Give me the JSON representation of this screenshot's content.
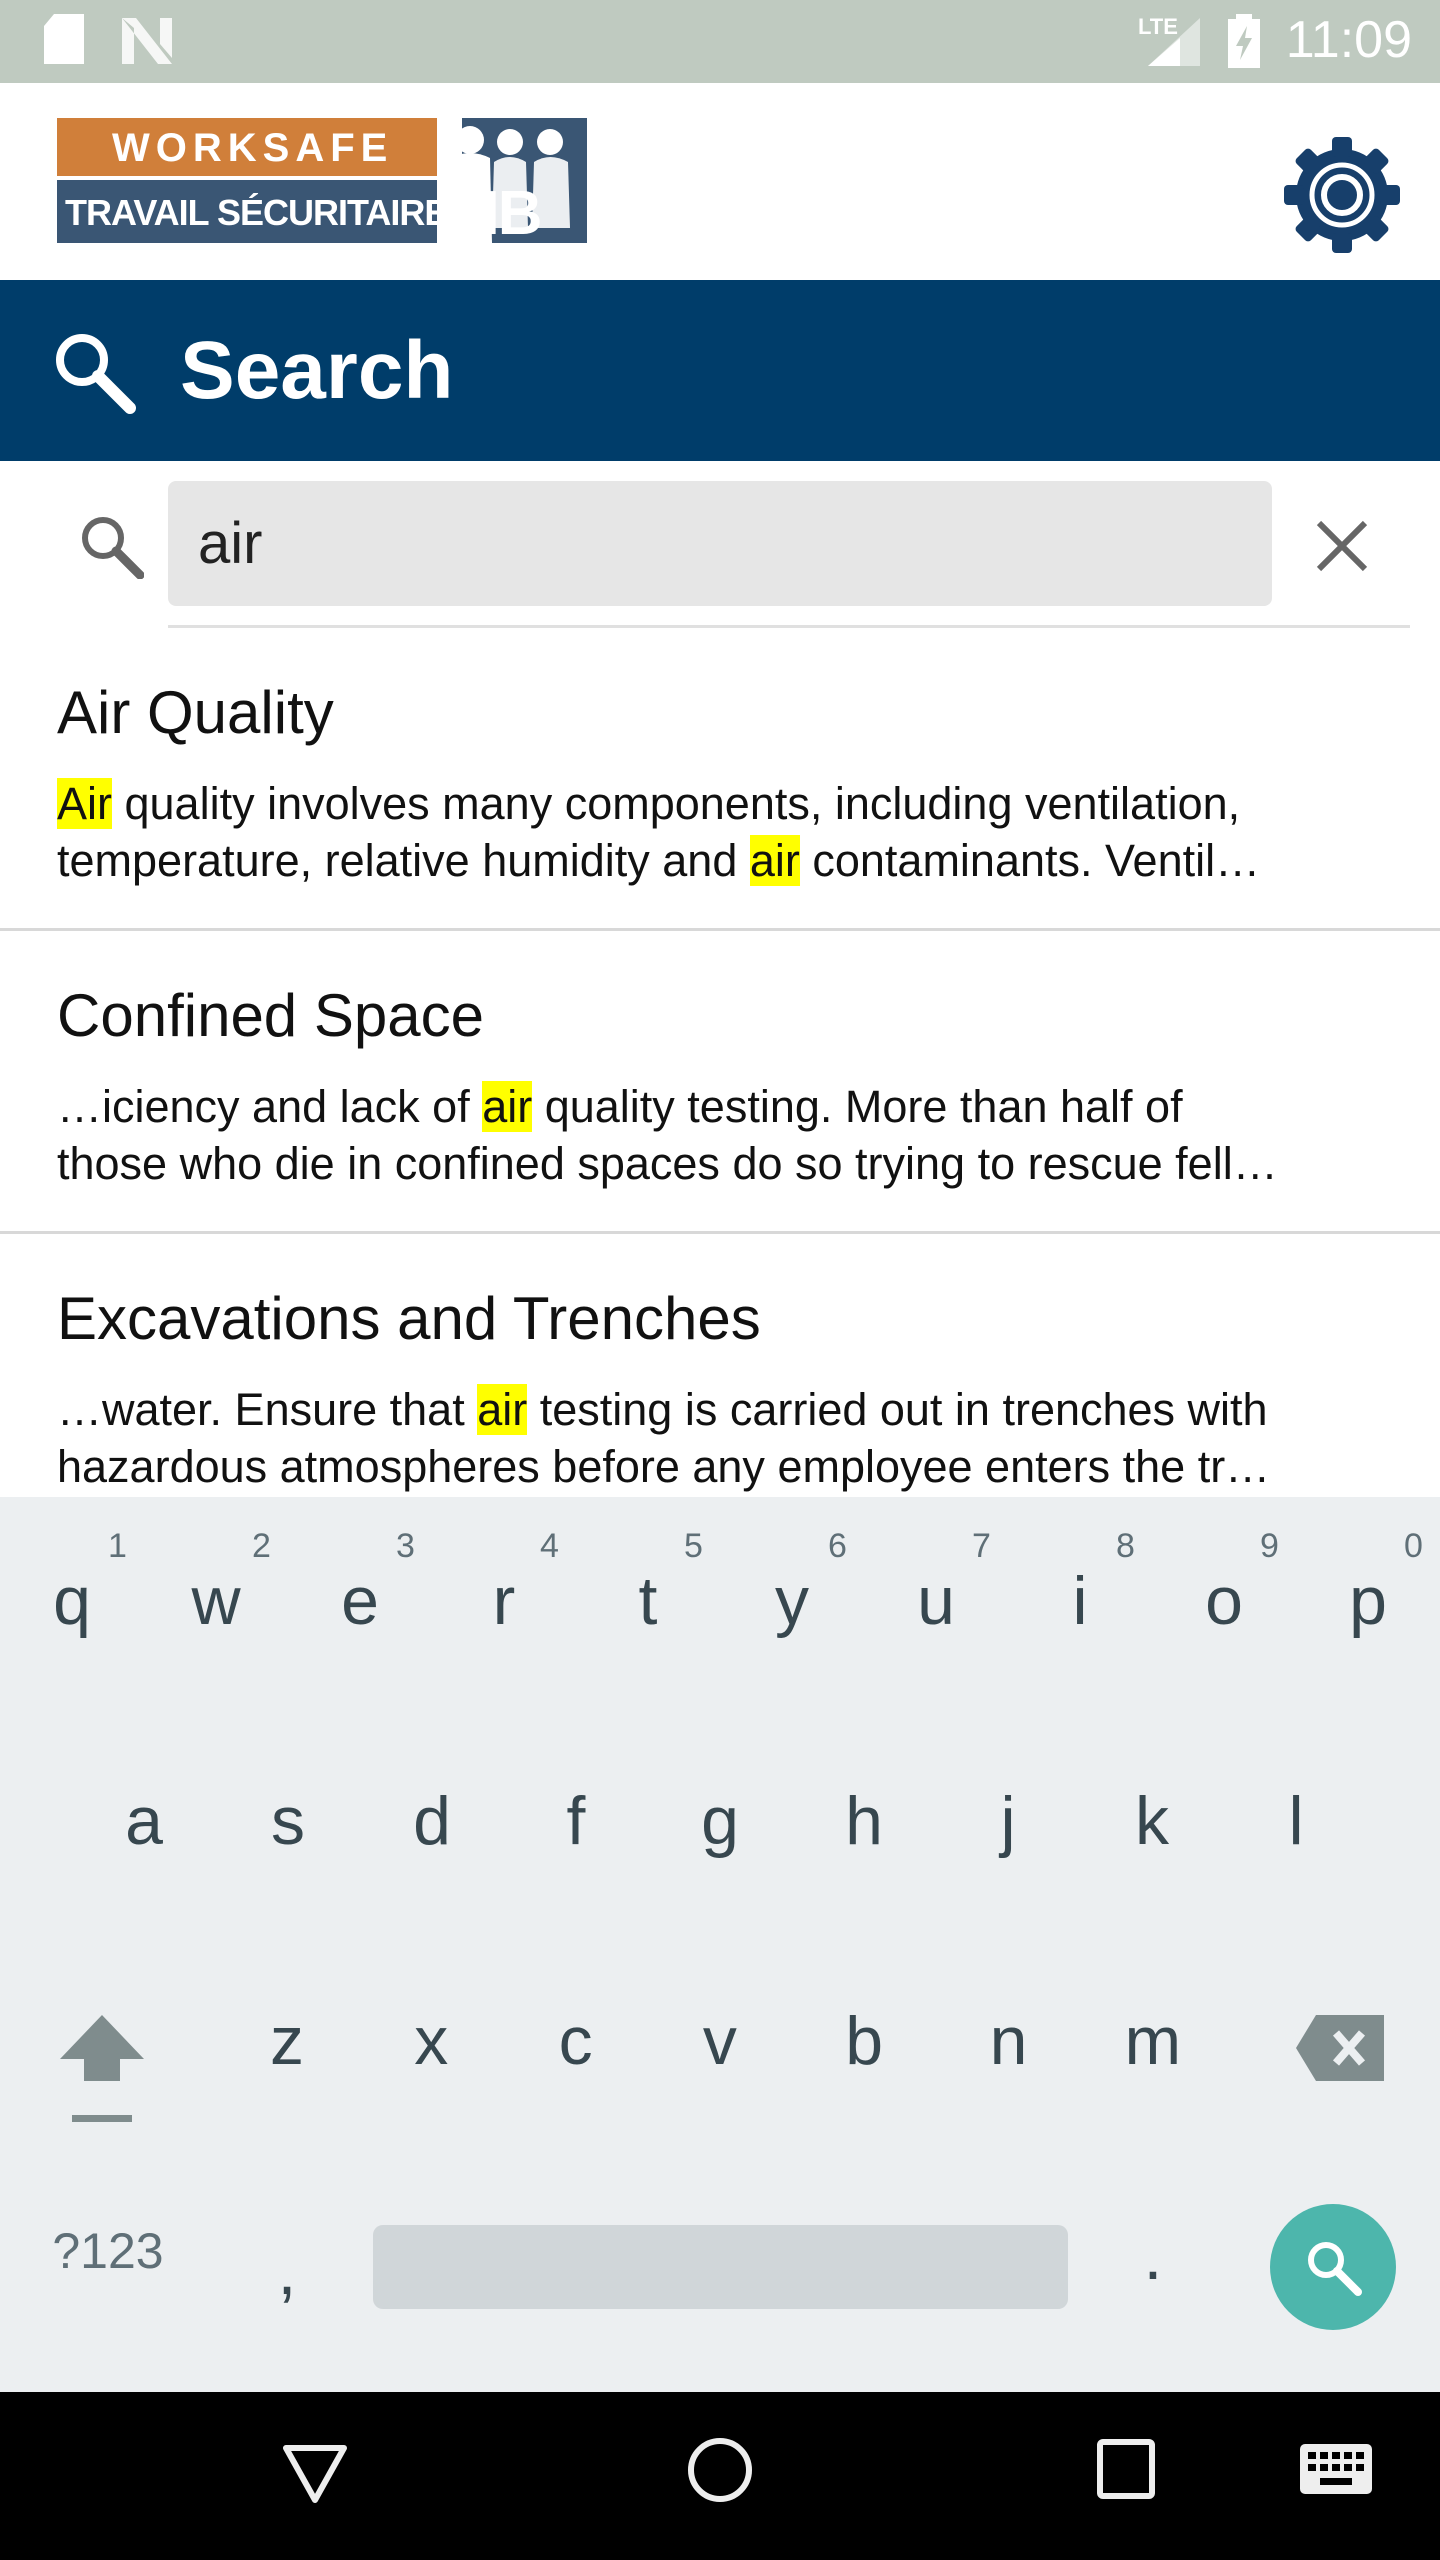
{
  "status_bar": {
    "time": "11:09",
    "network": "LTE",
    "icons": [
      "sd-card-icon",
      "n-icon",
      "signal-icon",
      "battery-charging-icon"
    ]
  },
  "header": {
    "logo_text_top": "WorkSafe",
    "logo_text_bottom": "Travail sécuritaire",
    "logo_text_nb": "NB",
    "settings_icon": "gear-icon"
  },
  "title_bar": {
    "title": "Search",
    "icon": "search-icon"
  },
  "search": {
    "value": "air",
    "placeholder": ""
  },
  "colors": {
    "title_bar": "#003d6a",
    "highlight": "#ffff00",
    "status_bar": "#bfcac0",
    "keyboard_action": "#4db6ac",
    "logo_orange": "#d07f3a",
    "logo_blue": "#3a5674"
  },
  "results": [
    {
      "title": "Air Quality",
      "lines": [
        [
          {
            "t": "Air",
            "hl": true
          },
          {
            "t": " quality involves many components, including ventilation,"
          }
        ],
        [
          {
            "t": "temperature, relative humidity and "
          },
          {
            "t": "air",
            "hl": true
          },
          {
            "t": " contaminants. Ventil…"
          }
        ]
      ]
    },
    {
      "title": "Confined Space",
      "lines": [
        [
          {
            "t": "…iciency and lack of "
          },
          {
            "t": "air",
            "hl": true
          },
          {
            "t": " quality testing. More than half of"
          }
        ],
        [
          {
            "t": "those who die in confined spaces do so trying to rescue fell…"
          }
        ]
      ]
    },
    {
      "title": "Excavations and Trenches",
      "lines": [
        [
          {
            "t": "…water. Ensure that "
          },
          {
            "t": "air",
            "hl": true
          },
          {
            "t": " testing is carried out in trenches with"
          }
        ],
        [
          {
            "t": "hazardous atmospheres before any employee enters the tr…"
          }
        ]
      ]
    }
  ],
  "keyboard": {
    "row1": [
      "q",
      "w",
      "e",
      "r",
      "t",
      "y",
      "u",
      "i",
      "o",
      "p"
    ],
    "row1_hints": [
      "1",
      "2",
      "3",
      "4",
      "5",
      "6",
      "7",
      "8",
      "9",
      "0"
    ],
    "row2": [
      "a",
      "s",
      "d",
      "f",
      "g",
      "h",
      "j",
      "k",
      "l"
    ],
    "row3": [
      "z",
      "x",
      "c",
      "v",
      "b",
      "n",
      "m"
    ],
    "symbols_label": "?123",
    "comma": ",",
    "period": "."
  }
}
